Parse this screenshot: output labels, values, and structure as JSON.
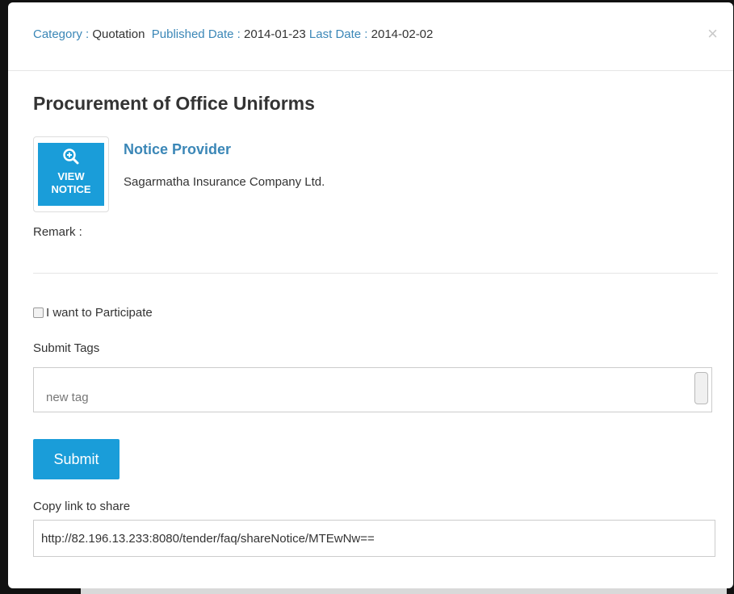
{
  "header": {
    "category_label": "Category :",
    "category_value": "Quotation",
    "published_label": "Published Date :",
    "published_value": "2014-01-23",
    "last_label": "Last Date :",
    "last_value": "2014-02-02",
    "close_glyph": "×"
  },
  "notice": {
    "title": "Procurement of Office Uniforms",
    "view_button": {
      "line1": "VIEW",
      "line2": "NOTICE",
      "icon": "zoom-in-icon"
    },
    "provider_label": "Notice Provider",
    "provider_name": "Sagarmatha Insurance Company Ltd.",
    "remark_label": "Remark :"
  },
  "form": {
    "participate_label": "I want to Participate",
    "participate_checked": false,
    "submit_tags_label": "Submit Tags",
    "tag_placeholder": "new tag",
    "submit_label": "Submit",
    "copy_link_label": "Copy link to share",
    "share_link": "http://82.196.13.233:8080/tender/faq/shareNotice/MTEwNw=="
  },
  "colors": {
    "accent": "#1a9dd9",
    "link": "#3b87b7",
    "text": "#333333"
  }
}
